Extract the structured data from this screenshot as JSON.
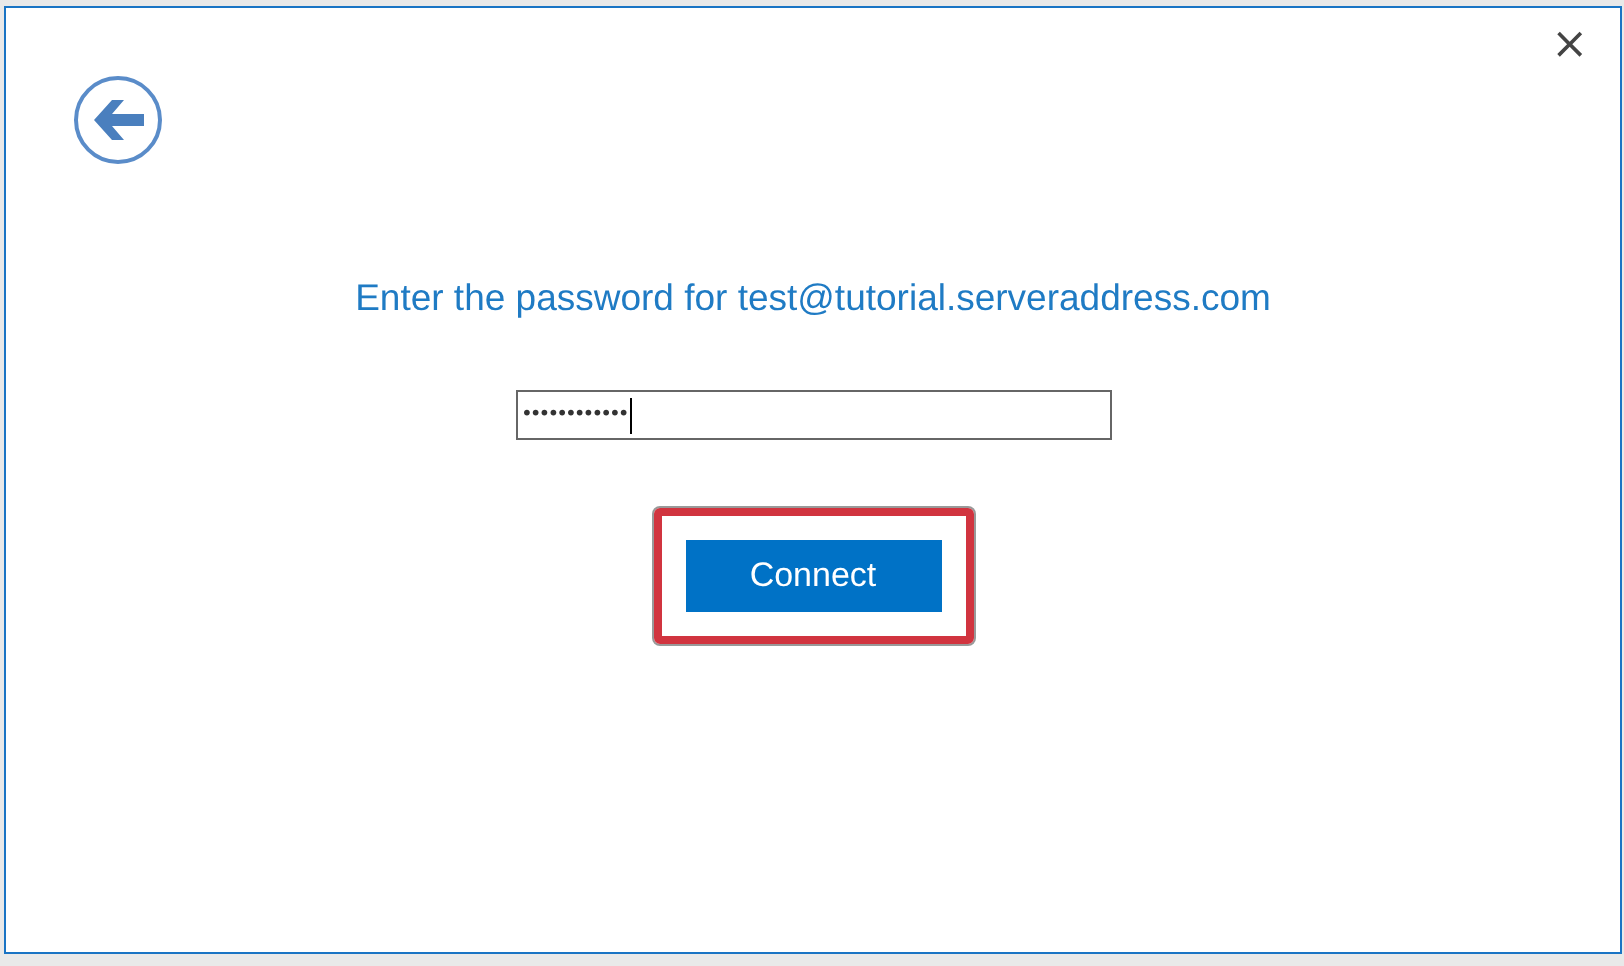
{
  "dialog": {
    "close": "×",
    "heading": "Enter the password for test@tutorial.serveraddress.com",
    "password": {
      "value": "••••••••••••"
    },
    "connect_button": {
      "label": "Connect",
      "highlighted": true
    }
  }
}
